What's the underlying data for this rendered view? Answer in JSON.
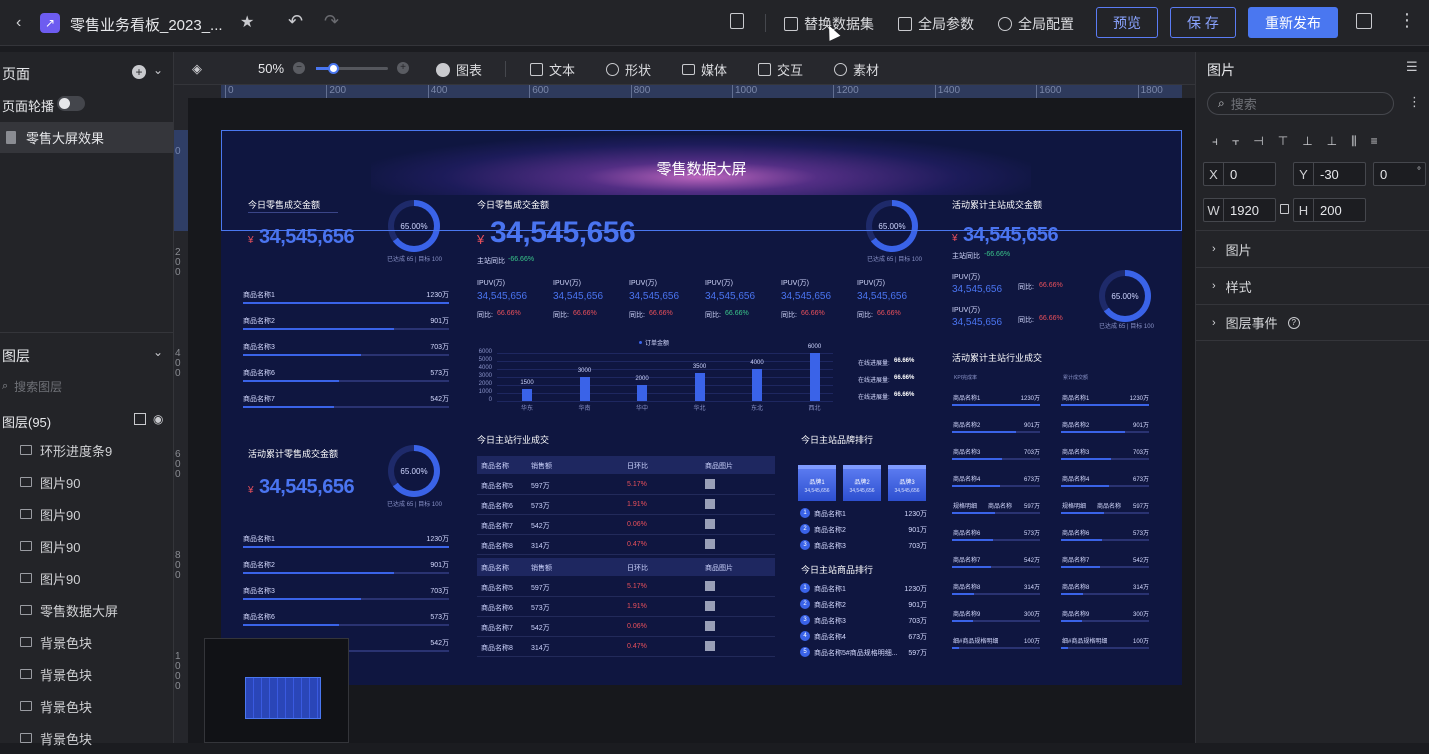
{
  "topbar": {
    "title": "零售业务看板_2023_...",
    "actions": {
      "replace": "替换数据集",
      "params": "全局参数",
      "config": "全局配置"
    },
    "preview": "预览",
    "save": "保 存",
    "republish": "重新发布"
  },
  "left": {
    "pages_title": "页面",
    "carousel": "页面轮播",
    "page_item": "零售大屏效果",
    "layers_title": "图层",
    "layer_search": "搜索图层",
    "layer_count": "图层(95)",
    "layers": [
      "环形进度条9",
      "图片90",
      "图片90",
      "图片90",
      "图片90",
      "零售数据大屏",
      "背景色块",
      "背景色块",
      "背景色块",
      "背景色块"
    ]
  },
  "toolbar": {
    "zoom": "50%",
    "chart": "图表",
    "text": "文本",
    "shape": "形状",
    "media": "媒体",
    "interact": "交互",
    "asset": "素材"
  },
  "ruler": {
    "h": [
      "0",
      "200",
      "400",
      "600",
      "800",
      "1000",
      "1200",
      "1400",
      "1600",
      "1800"
    ],
    "v": [
      "0",
      "200",
      "400",
      "600",
      "800",
      "1000"
    ]
  },
  "right": {
    "title": "图片",
    "search": "搜索",
    "x": "0",
    "y": "-30",
    "r": "0",
    "w": "1920",
    "h": "200",
    "sec1": "图片",
    "sec2": "样式",
    "sec3": "图层事件"
  },
  "dash": {
    "title": "零售数据大屏",
    "k1": "今日零售成交金额",
    "k1v": "34,545,656",
    "ring": "65.00%",
    "ringsub": "已达成 65 | 目标 100",
    "k2": "今日零售成交金额",
    "k2v": "34,545,656",
    "k2sub": "主站同比",
    "k2pct": "-66.66%",
    "k3": "活动累计主站成交金额",
    "k3v": "34,545,656",
    "k3sub": "主站同比",
    "k3pct": "-66.66%",
    "k4": "活动累计零售成交金额",
    "k4v": "34,545,656",
    "list1": [
      [
        "商品名称1",
        "1230万"
      ],
      [
        "商品名称2",
        "901万"
      ],
      [
        "商品名称3",
        "703万"
      ],
      [
        "商品名称6",
        "573万"
      ],
      [
        "商品名称7",
        "542万"
      ]
    ],
    "list2": [
      [
        "商品名称1",
        "1230万"
      ],
      [
        "商品名称2",
        "901万"
      ],
      [
        "商品名称3",
        "703万"
      ],
      [
        "商品名称6",
        "573万"
      ],
      [
        "商品名称7",
        "542万"
      ]
    ],
    "ipuv": [
      {
        "l": "IPUV(万)",
        "v": "34,545,656",
        "c": "同比:",
        "p": "66.66%"
      },
      {
        "l": "IPUV(万)",
        "v": "34,545,656",
        "c": "同比:",
        "p": "66.66%"
      },
      {
        "l": "IPUV(万)",
        "v": "34,545,656",
        "c": "同比:",
        "p": "66.66%"
      },
      {
        "l": "IPUV(万)",
        "v": "34,545,656",
        "c": "同比:",
        "p": "66.66%"
      },
      {
        "l": "IPUV(万)",
        "v": "34,545,656",
        "c": "同比:",
        "p": "66.66%"
      },
      {
        "l": "IPUV(万)",
        "v": "34,545,656",
        "c": "同比:",
        "p": "66.66%"
      }
    ],
    "ipuv_r": [
      {
        "l": "IPUV(万)",
        "v": "34,545,656",
        "c": "同比:",
        "p": "66.66%"
      },
      {
        "l": "IPUV(万)",
        "v": "34,545,656",
        "c": "同比:",
        "p": "66.66%"
      }
    ],
    "chart_legend": "订单金额",
    "chart_notes": [
      [
        "在线进展量:",
        "66.66%"
      ],
      [
        "在线进展量:",
        "66.66%"
      ],
      [
        "在线进展量:",
        "66.66%"
      ]
    ],
    "table_title": "今日主站行业成交",
    "table_head": [
      "商品名称",
      "销售额",
      "日环比",
      "商品图片"
    ],
    "table_rows": [
      [
        "商品名称5",
        "597万",
        "5.17%"
      ],
      [
        "商品名称6",
        "573万",
        "1.91%"
      ],
      [
        "商品名称7",
        "542万",
        "0.06%"
      ],
      [
        "商品名称8",
        "314万",
        "0.47%"
      ]
    ],
    "brand_title": "今日主站品牌排行",
    "brands": [
      [
        "品牌1",
        "34,545,656"
      ],
      [
        "品牌2",
        "34,545,656"
      ],
      [
        "品牌3",
        "34,545,656"
      ]
    ],
    "brand_list": [
      [
        "1",
        "商品名称1",
        "1230万"
      ],
      [
        "2",
        "商品名称2",
        "901万"
      ],
      [
        "3",
        "商品名称3",
        "703万"
      ]
    ],
    "goods_title": "今日主站商品排行",
    "goods": [
      [
        "1",
        "商品名称1",
        "1230万"
      ],
      [
        "2",
        "商品名称2",
        "901万"
      ],
      [
        "3",
        "商品名称3",
        "703万"
      ],
      [
        "4",
        "商品名称4",
        "673万"
      ],
      [
        "5",
        "商品名称5#商品规格明细...",
        "597万"
      ]
    ],
    "right_title": "活动累计主站行业成交",
    "rcol_heads": [
      "KPI完成率",
      "累计成交额"
    ],
    "rlist": [
      [
        "商品名称1",
        "1230万"
      ],
      [
        "商品名称2",
        "901万"
      ],
      [
        "商品名称3",
        "703万"
      ],
      [
        "商品名称4",
        "673万"
      ],
      [
        "规格明细",
        "商品名称",
        "597万"
      ],
      [
        "商品名称6",
        "573万"
      ],
      [
        "商品名称7",
        "542万"
      ],
      [
        "商品名称8",
        "314万"
      ],
      [
        "商品名称9",
        "300万"
      ],
      [
        "细#商品规格明细",
        "100万"
      ]
    ]
  },
  "chart_data": {
    "type": "bar",
    "categories": [
      "华东",
      "华南",
      "华中",
      "华北",
      "东北",
      "西北"
    ],
    "values": [
      1500,
      3000,
      2000,
      3500,
      4000,
      6000
    ],
    "ylim": [
      0,
      6000
    ],
    "yticks": [
      "0",
      "1000",
      "2000",
      "3000",
      "4000",
      "5000",
      "6000"
    ],
    "series": [
      {
        "name": "订单金额",
        "values": [
          1500,
          3000,
          2000,
          3500,
          4000,
          6000
        ]
      }
    ]
  },
  "colors": {
    "accent": "#4a77f0",
    "canvas": "#0f1640",
    "up": "#e8505b",
    "down": "#3ac58a"
  }
}
